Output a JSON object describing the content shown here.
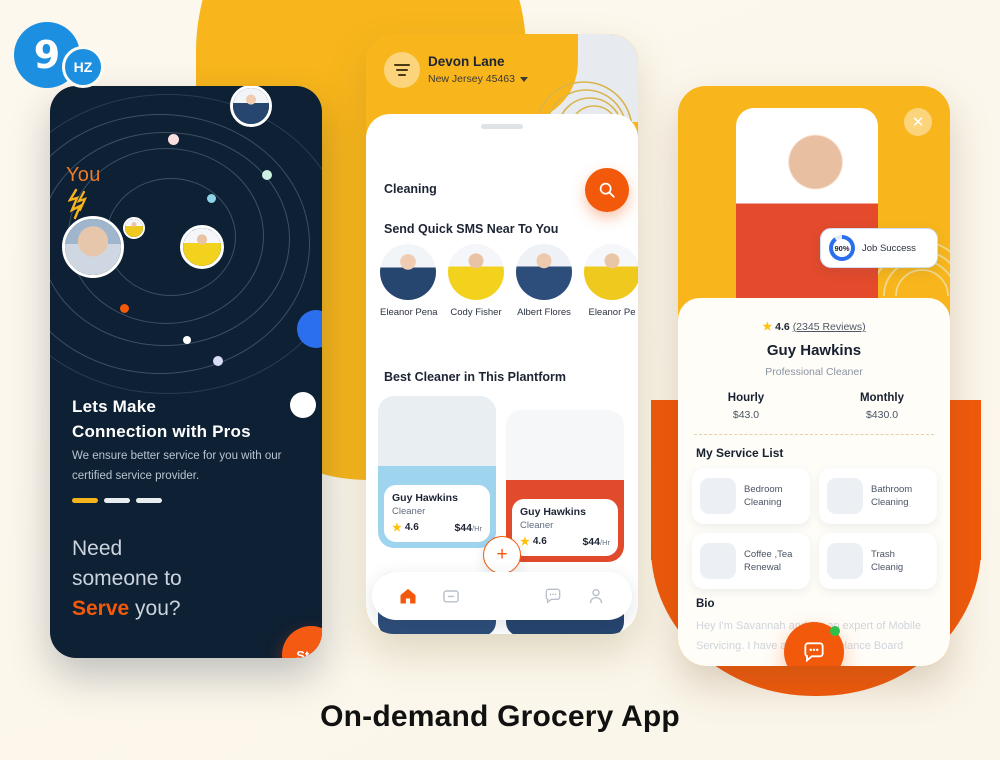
{
  "logo": {
    "mark": "9",
    "suffix": "HZ"
  },
  "caption": "On-demand Grocery App",
  "colors": {
    "yellow": "#F8B61C",
    "orange": "#F2590B",
    "dark": "#0E2033",
    "blue": "#2C6FEE",
    "star": "#FFC107"
  },
  "phone_onboarding": {
    "you_label": "You",
    "headline_line1": "Lets Make",
    "headline_line2": "Connection with Pros",
    "subtext": "We ensure better service for you with our certified service provider.",
    "pager": {
      "total": 3,
      "active_index": 0
    },
    "cta_line1": "Need",
    "cta_line2": "someone to",
    "cta_highlight": "Serve",
    "cta_line3_rest": " you?",
    "start_button": "Start"
  },
  "phone_home": {
    "user_name": "Devon Lane",
    "location": "New Jersey 45463",
    "category": "Cleaning",
    "search_icon": "search-icon",
    "sms_section_title": "Send Quick SMS Near To You",
    "people": [
      {
        "name": "Eleanor Pena"
      },
      {
        "name": "Cody Fisher"
      },
      {
        "name": "Albert Flores"
      },
      {
        "name": "Eleanor Pe"
      }
    ],
    "best_section_title": "Best Cleaner in This Plantform",
    "cleaners": [
      {
        "name": "Guy Hawkins",
        "role": "Cleaner",
        "rating": "4.6",
        "price": "$44",
        "price_unit": "/Hr"
      },
      {
        "name": "Guy Hawkins",
        "role": "Cleaner",
        "rating": "4.6",
        "price": "$44",
        "price_unit": "/Hr"
      }
    ],
    "nav": [
      {
        "icon": "home-icon",
        "active": true
      },
      {
        "icon": "folder-icon",
        "active": false
      },
      {
        "icon": "add-icon",
        "active": false
      },
      {
        "icon": "chat-icon",
        "active": false
      },
      {
        "icon": "profile-icon",
        "active": false
      }
    ],
    "add_button_label": "+"
  },
  "phone_profile": {
    "close_label": "✕",
    "job_success_percent": "90%",
    "job_success_label": "Job Success",
    "rating": "4.6",
    "reviews": "(2345 Reviews)",
    "name": "Guy Hawkins",
    "role": "Professional Cleaner",
    "rates": [
      {
        "label": "Hourly",
        "value": "$43.0"
      },
      {
        "label": "Monthly",
        "value": "$430.0"
      }
    ],
    "service_list_title": "My Service List",
    "services": [
      {
        "label": "Bedroom Cleaning"
      },
      {
        "label": "Bathroom Cleaning"
      },
      {
        "label": "Coffee ,Tea Renewal"
      },
      {
        "label": "Trash Cleanig"
      }
    ],
    "bio_title": "Bio",
    "bio_text": "Hey I'm Savannah and I'm an expert of Mobile Servicing. I have also got Freelance Board"
  }
}
